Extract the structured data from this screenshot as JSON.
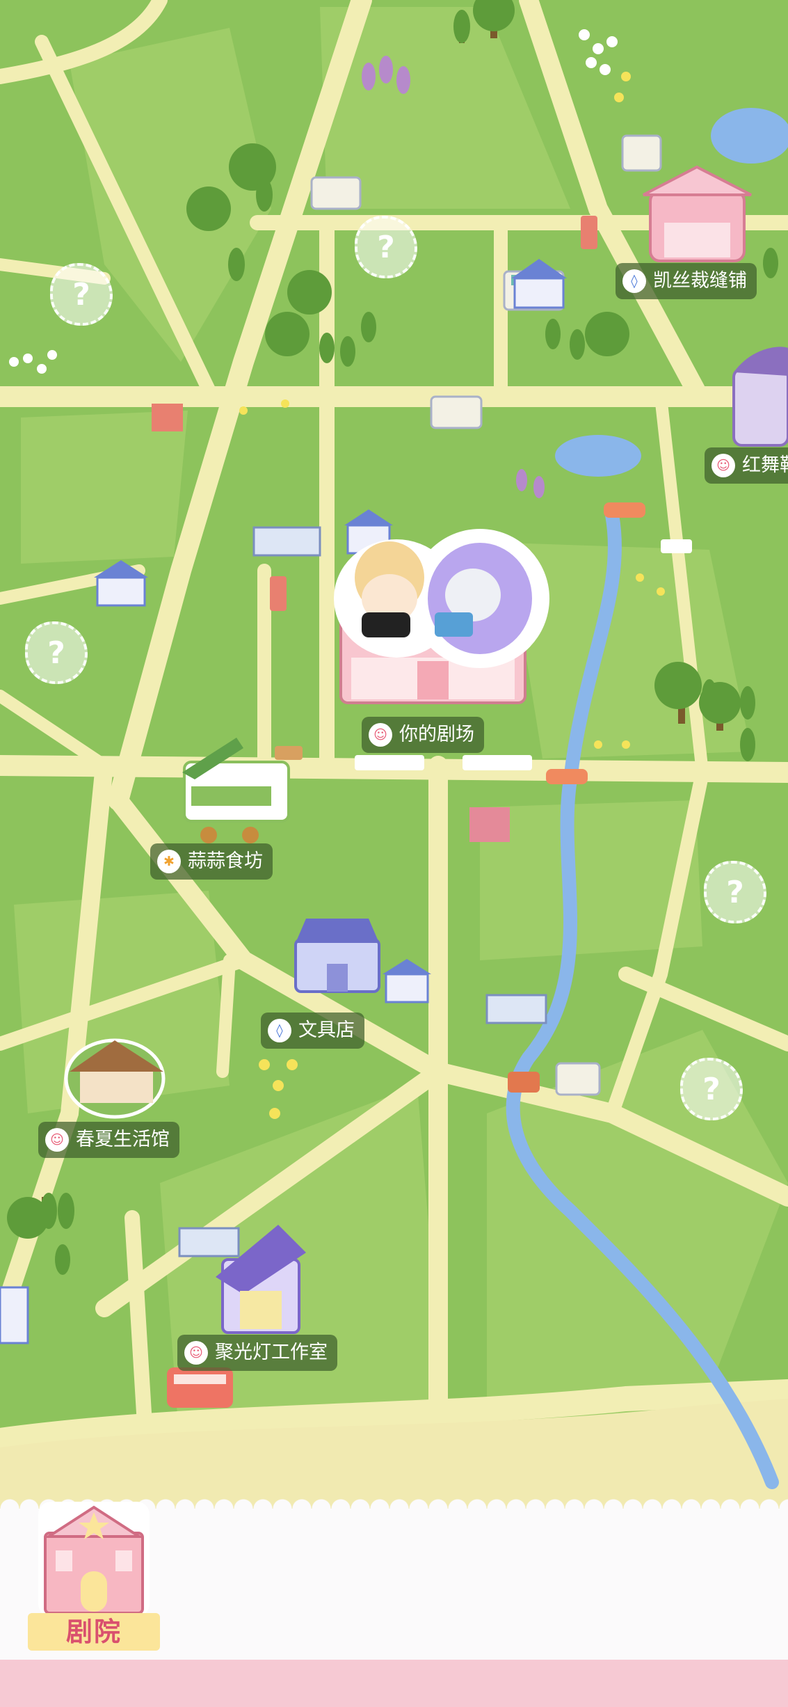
{
  "map": {
    "locations": [
      {
        "name": "凯丝裁缝铺",
        "icon": "shop-bag-icon"
      },
      {
        "name": "红舞鞋",
        "icon": "theater-mask-icon"
      },
      {
        "name": "你的剧场",
        "icon": "theater-mask-icon"
      },
      {
        "name": "蒜蒜食坊",
        "icon": "fork-knife-icon"
      },
      {
        "name": "文具店",
        "icon": "shop-bag-icon"
      },
      {
        "name": "春夏生活馆",
        "icon": "theater-mask-icon"
      },
      {
        "name": "聚光灯工作室",
        "icon": "theater-mask-icon"
      }
    ],
    "locked_marker": "?"
  },
  "bottom_nav": {
    "theater_tab_label": "剧院"
  },
  "colors": {
    "grass": "#8dc35c",
    "grass_light": "#a4d06c",
    "road": "#f2eeb4",
    "river": "#8ab6ea",
    "label_bg": "#3e602c",
    "accent_pink": "#e8607a"
  }
}
